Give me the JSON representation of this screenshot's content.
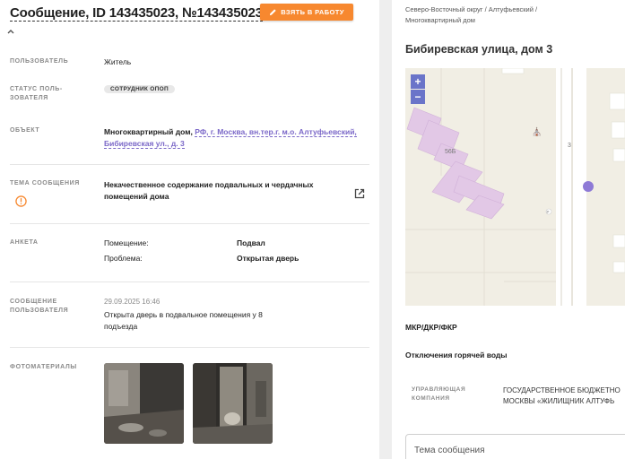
{
  "header": {
    "title": "Сообщение, ID 143435023, №143435023",
    "take_button": "ВЗЯТЬ В РАБОТУ"
  },
  "details": {
    "user": {
      "label": "ПОЛЬЗОВАТЕЛЬ",
      "value": "Житель"
    },
    "user_status": {
      "label_line1": "СТАТУС ПОЛЬ-",
      "label_line2": "ЗОВАТЕЛЯ",
      "badge": "СОТРУДНИК ОПОП"
    },
    "object": {
      "label": "ОБЪЕКТ",
      "type": "Многоквартирный дом,",
      "address_line1": "РФ, г. Москва, вн.тер.г. м.о. Алтуфьевский,",
      "address_line2": "Бибиревская ул., д. 3"
    },
    "topic": {
      "label": "ТЕМА СООБЩЕНИЯ",
      "line1": "Некачественное содержание подвальных и чердачных",
      "line2": "помещений дома"
    },
    "survey": {
      "label": "АНКЕТА",
      "rows": [
        {
          "key": "Помещение:",
          "value": "Подвал"
        },
        {
          "key": "Проблема:",
          "value": "Открытая дверь"
        }
      ]
    },
    "message": {
      "label_line1": "СООБЩЕНИЕ",
      "label_line2": "ПОЛЬЗОВАТЕЛЯ",
      "timestamp": "29.09.2025 16:46",
      "text_line1": "Открыта дверь в подвальное помещения у 8",
      "text_line2": "подъезда"
    },
    "photos": {
      "label": "ФОТОМАТЕРИАЛЫ"
    }
  },
  "right": {
    "breadcrumb_line1": "Северо-Восточный округ / Алтуфьевский /",
    "breadcrumb_line2": "Многоквартирный дом",
    "address": "Бибиревская улица, дом 3",
    "map": {
      "zoom_in": "+",
      "zoom_out": "−",
      "label_56b": "56Б",
      "label_3": "3",
      "label_p": "P"
    },
    "section1": "МКР/ДКР/ФКР",
    "section2": "Отключения горячей воды",
    "uk_label_line1": "УПРАВЛЯЮЩАЯ",
    "uk_label_line2": "КОМПАНИЯ",
    "uk_value_line1": "ГОСУДАРСТВЕННОЕ БЮДЖЕТНО",
    "uk_value_line2": "МОСКВЫ «ЖИЛИЩНИК АЛТУФЬ",
    "topic_placeholder": "Тема сообщения"
  },
  "colors": {
    "accent_orange": "#f7882f",
    "link_purple": "#7b68c8",
    "map_zoom": "#6a74c9"
  }
}
